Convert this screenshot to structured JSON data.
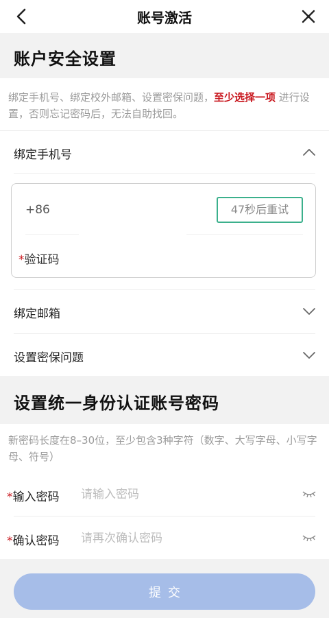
{
  "header": {
    "title": "账号激活",
    "back_icon": "chevron-left-icon",
    "close_icon": "close-icon"
  },
  "security": {
    "title": "账户安全设置",
    "desc_before": "绑定手机号、绑定校外邮箱、设置密保问题，",
    "desc_highlight": "至少选择一项",
    "desc_after": " 进行设置，否则忘记密码后，无法自助找回。",
    "highlight_color": "#c8161d"
  },
  "phone": {
    "label": "绑定手机号",
    "country_code": "+86",
    "retry_label": "47秒后重试",
    "code_star": "*",
    "code_label": "验证码",
    "accent_color": "#3bb08c"
  },
  "email": {
    "label": "绑定邮箱"
  },
  "question": {
    "label": "设置密保问题"
  },
  "password_section": {
    "title": "设置统一身份认证账号密码",
    "desc": "新密码长度在8–30位，至少包含3种字符（数字、大写字母、小写字母、符号）",
    "password": {
      "star": "*",
      "label": "输入密码",
      "placeholder": "请输入密码"
    },
    "confirm": {
      "star": "*",
      "label": "确认密码",
      "placeholder": "请再次确认密码"
    }
  },
  "submit": {
    "label": "提交",
    "color": "#a6bde8"
  }
}
